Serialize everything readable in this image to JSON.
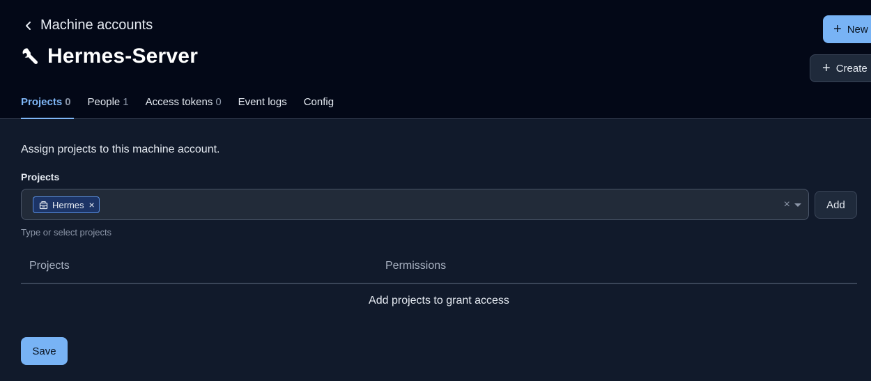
{
  "header": {
    "back_label": "Machine accounts",
    "title": "Hermes-Server",
    "new_label": "New",
    "create_label": "Create"
  },
  "tabs": [
    {
      "label": "Projects",
      "count": "0",
      "active": true
    },
    {
      "label": "People",
      "count": "1",
      "active": false
    },
    {
      "label": "Access tokens",
      "count": "0",
      "active": false
    },
    {
      "label": "Event logs",
      "count": "",
      "active": false
    },
    {
      "label": "Config",
      "count": "",
      "active": false
    }
  ],
  "content": {
    "description": "Assign projects to this machine account.",
    "projects_label": "Projects",
    "selected_chip": "Hermes",
    "hint": "Type or select projects",
    "add_label": "Add",
    "table": {
      "columns": [
        "Projects",
        "Permissions"
      ],
      "empty_message": "Add projects to grant access"
    },
    "save_label": "Save"
  },
  "colors": {
    "header_bg": "#030817",
    "page_bg": "#111a2b",
    "accent": "#7fb6f6",
    "primary_button": "#78b3f5"
  },
  "icons": {
    "back": "chevron-left-icon",
    "title": "wrench-icon",
    "chip": "project-icon",
    "add": "plus-icon"
  }
}
